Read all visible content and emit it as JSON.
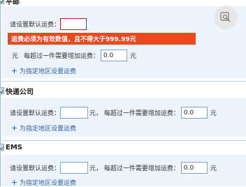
{
  "sections": [
    {
      "title": "平邮",
      "default_label": "请设置默认运费：",
      "default_value": "",
      "error": "运费必须为有效数值，且不得大于999.99元",
      "unit": "元",
      "extra_label": "元，  每超过一件需要增加运费：",
      "extra_value": "0.0",
      "extra_unit": "元",
      "link": "为指定地区设置运费"
    },
    {
      "title": "快递公司",
      "default_label": "请设置默认运费：",
      "default_value": "",
      "extra_label": "元，  每超过一件需要增加运费：",
      "extra_value": "0.0",
      "extra_unit": "元",
      "link": "为指定地区设置运费"
    },
    {
      "title": "EMS",
      "default_label": "请设置默认运费：",
      "default_value": "",
      "extra_label": "元，  每超过一件需要增加运费：",
      "extra_value": "0.0",
      "extra_unit": "元",
      "link": "为指定地区设置运费"
    }
  ],
  "icons": {
    "corner": "image-search-icon",
    "add": "plus-icon",
    "checkbox": "checkbox-icon"
  },
  "colors": {
    "error_bg": "#e8491d",
    "panel_bg": "#eef4fb",
    "link": "#2d5fa8"
  }
}
